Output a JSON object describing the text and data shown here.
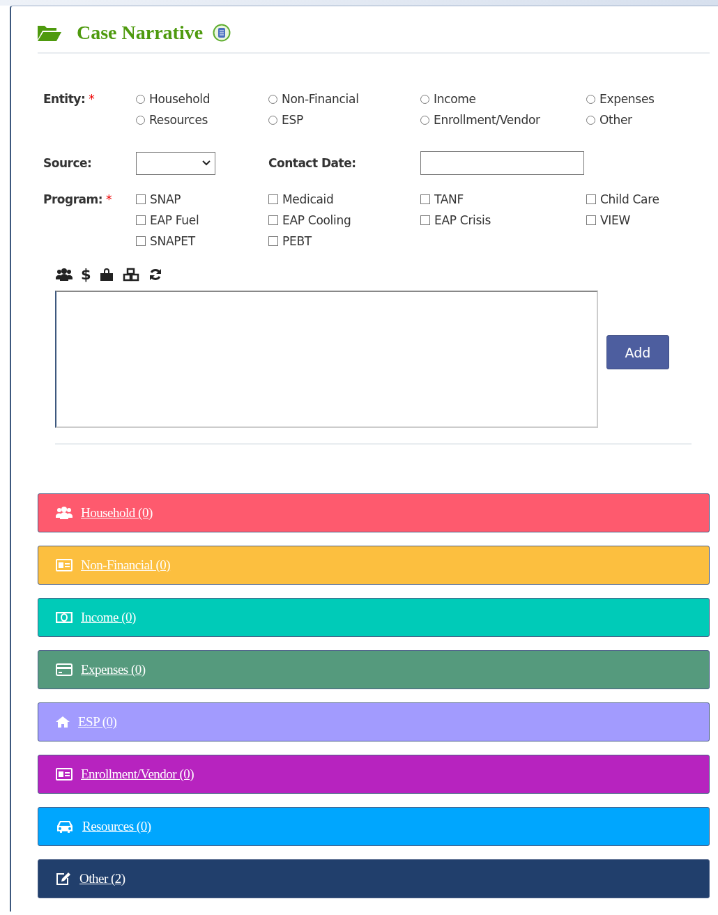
{
  "title": "Case Narrative",
  "entity": {
    "label": "Entity:",
    "required_mark": "*",
    "options": [
      {
        "label": "Household",
        "selected": false
      },
      {
        "label": "Non-Financial",
        "selected": false
      },
      {
        "label": "Income",
        "selected": false
      },
      {
        "label": "Expenses",
        "selected": false
      },
      {
        "label": "Resources",
        "selected": false
      },
      {
        "label": "ESP",
        "selected": false
      },
      {
        "label": "Enrollment/Vendor",
        "selected": false
      },
      {
        "label": "Other",
        "selected": false
      }
    ]
  },
  "source": {
    "label": "Source:"
  },
  "contact_date": {
    "label": "Contact Date:"
  },
  "program": {
    "label": "Program:",
    "required_mark": "*",
    "options": [
      {
        "label": "SNAP",
        "checked": false
      },
      {
        "label": "Medicaid",
        "checked": false
      },
      {
        "label": "TANF",
        "checked": false
      },
      {
        "label": "Child Care",
        "checked": false
      },
      {
        "label": "EAP Fuel",
        "checked": false
      },
      {
        "label": "EAP Cooling",
        "checked": false
      },
      {
        "label": "EAP Crisis",
        "checked": false
      },
      {
        "label": "VIEW",
        "checked": false
      },
      {
        "label": "SNAPET",
        "checked": false
      },
      {
        "label": "PEBT",
        "checked": false
      }
    ]
  },
  "toolbar": [
    {
      "kind": "users"
    },
    {
      "kind": "dollar",
      "glyph": "$"
    },
    {
      "kind": "bag"
    },
    {
      "kind": "cubes"
    },
    {
      "kind": "refresh"
    }
  ],
  "add_button": "Add",
  "sections": [
    {
      "kind": "users",
      "label": "Household (0)",
      "color": "#fe5a6e"
    },
    {
      "kind": "idcard",
      "label": "Non-Financial (0)",
      "color": "#fcbf3f"
    },
    {
      "kind": "money",
      "label": "Income (0)",
      "color": "#00cbb8"
    },
    {
      "kind": "card",
      "label": "Expenses (0)",
      "color": "#559a7d"
    },
    {
      "kind": "home",
      "label": "ESP (0)",
      "color": "#a29bfe"
    },
    {
      "kind": "idcard",
      "label": "Enrollment/Vendor (0)",
      "color": "#b723bf"
    },
    {
      "kind": "car",
      "label": "Resources (0)",
      "color": "#00a6fe"
    },
    {
      "kind": "edit",
      "label": "Other (2)",
      "color": "#213f6c"
    }
  ]
}
